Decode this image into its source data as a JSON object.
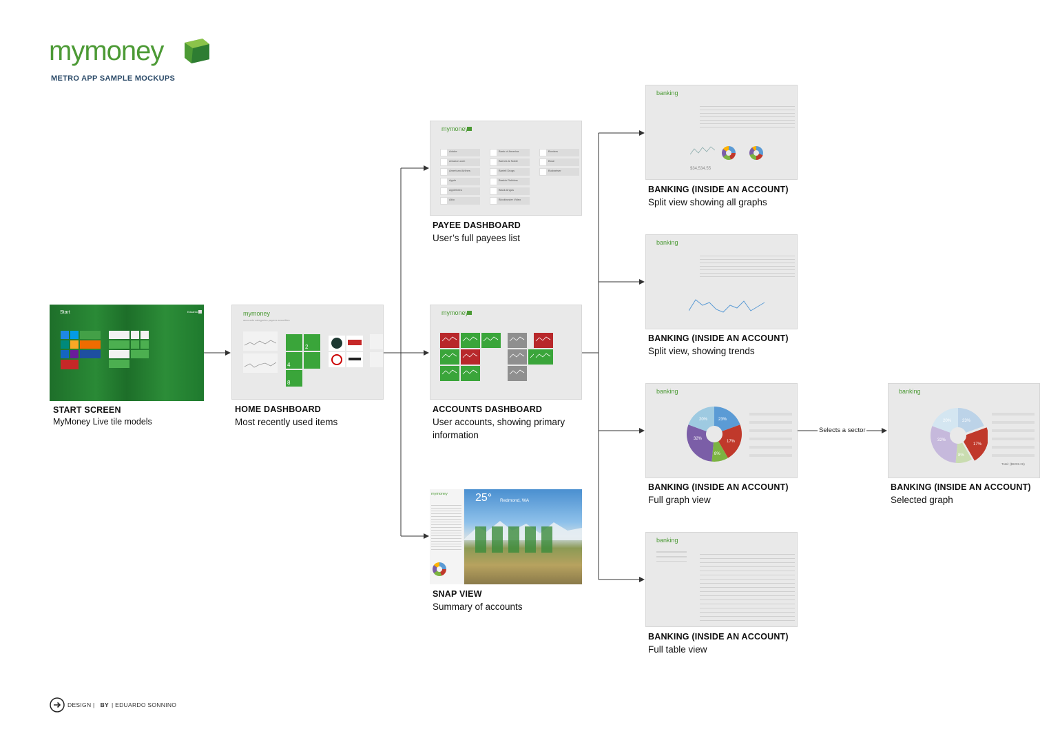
{
  "header": {
    "logo": "mymoney",
    "subtitle": "METRO APP SAMPLE MOCKUPS"
  },
  "screens": {
    "start": {
      "title": "START SCREEN",
      "desc": "MyMoney Live tile models",
      "thumb_label": "Start",
      "user": "Eduardo"
    },
    "home": {
      "title": "HOME DASHBOARD",
      "desc": "Most recently used items",
      "app": "mymoney",
      "tabs": "accounts   categories   payees   securities",
      "tile_numbers": [
        "2",
        "4",
        "8"
      ]
    },
    "payee": {
      "title": "PAYEE DASHBOARD",
      "desc": "User’s full payees list",
      "app": "mymoney",
      "payees": [
        "Adobe",
        "Amazon.com",
        "American Airlines",
        "Apple",
        "Applebees",
        "Aldo",
        "Bank of America",
        "Barnes & Noble",
        "Bartell Drugs",
        "Baskin Robbins",
        "Black Angus",
        "Blockbuster Video",
        "Borders",
        "Bose",
        "Budweiser"
      ]
    },
    "accounts": {
      "title": "ACCOUNTS DASHBOARD",
      "desc": "User accounts, showing primary information",
      "app": "mymoney"
    },
    "snap": {
      "title": "SNAP VIEW",
      "desc": "Summary of accounts",
      "app": "mymoney",
      "temperature": "25°",
      "city": "Redmond, WA"
    },
    "bank_all": {
      "title": "BANKING (INSIDE AN ACCOUNT)",
      "desc": "Split view showing all graphs",
      "app": "banking",
      "balance": "$34,534.55"
    },
    "bank_trends": {
      "title": "BANKING (INSIDE AN ACCOUNT)",
      "desc": "Split view, showing trends",
      "app": "banking"
    },
    "bank_graph": {
      "title": "BANKING (INSIDE AN ACCOUNT)",
      "desc": "Full graph view",
      "app": "banking",
      "slice_labels": [
        "20%",
        "23%",
        "17%",
        "8%",
        "32%"
      ]
    },
    "bank_selected": {
      "title": "BANKING (INSIDE AN ACCOUNT)",
      "desc": "Selected graph",
      "app": "banking",
      "slice_labels": [
        "20%",
        "23%",
        "17%",
        "8%",
        "32%"
      ],
      "total": "Total: ($8299.26)"
    },
    "bank_table": {
      "title": "BANKING (INSIDE AN ACCOUNT)",
      "desc": "Full table view",
      "app": "banking"
    }
  },
  "edge_label": "Selects a sector",
  "footer": {
    "design": "DESIGN |",
    "by": "BY",
    "author": "| EDUARDO SONNINO"
  },
  "colors": {
    "brand_green": "#4c9a35",
    "start_green": "#1f7a2e",
    "tile_green": "#3aa53a",
    "tile_red": "#b8282b",
    "tile_gray": "#8f8f8f",
    "thumb_bg": "#e9e9e9",
    "pie_blue": "#5b9bd5",
    "pie_red": "#c0392b",
    "pie_green": "#7cb342",
    "pie_purple": "#7b5ea7",
    "pie_light": "#9ecae1"
  }
}
